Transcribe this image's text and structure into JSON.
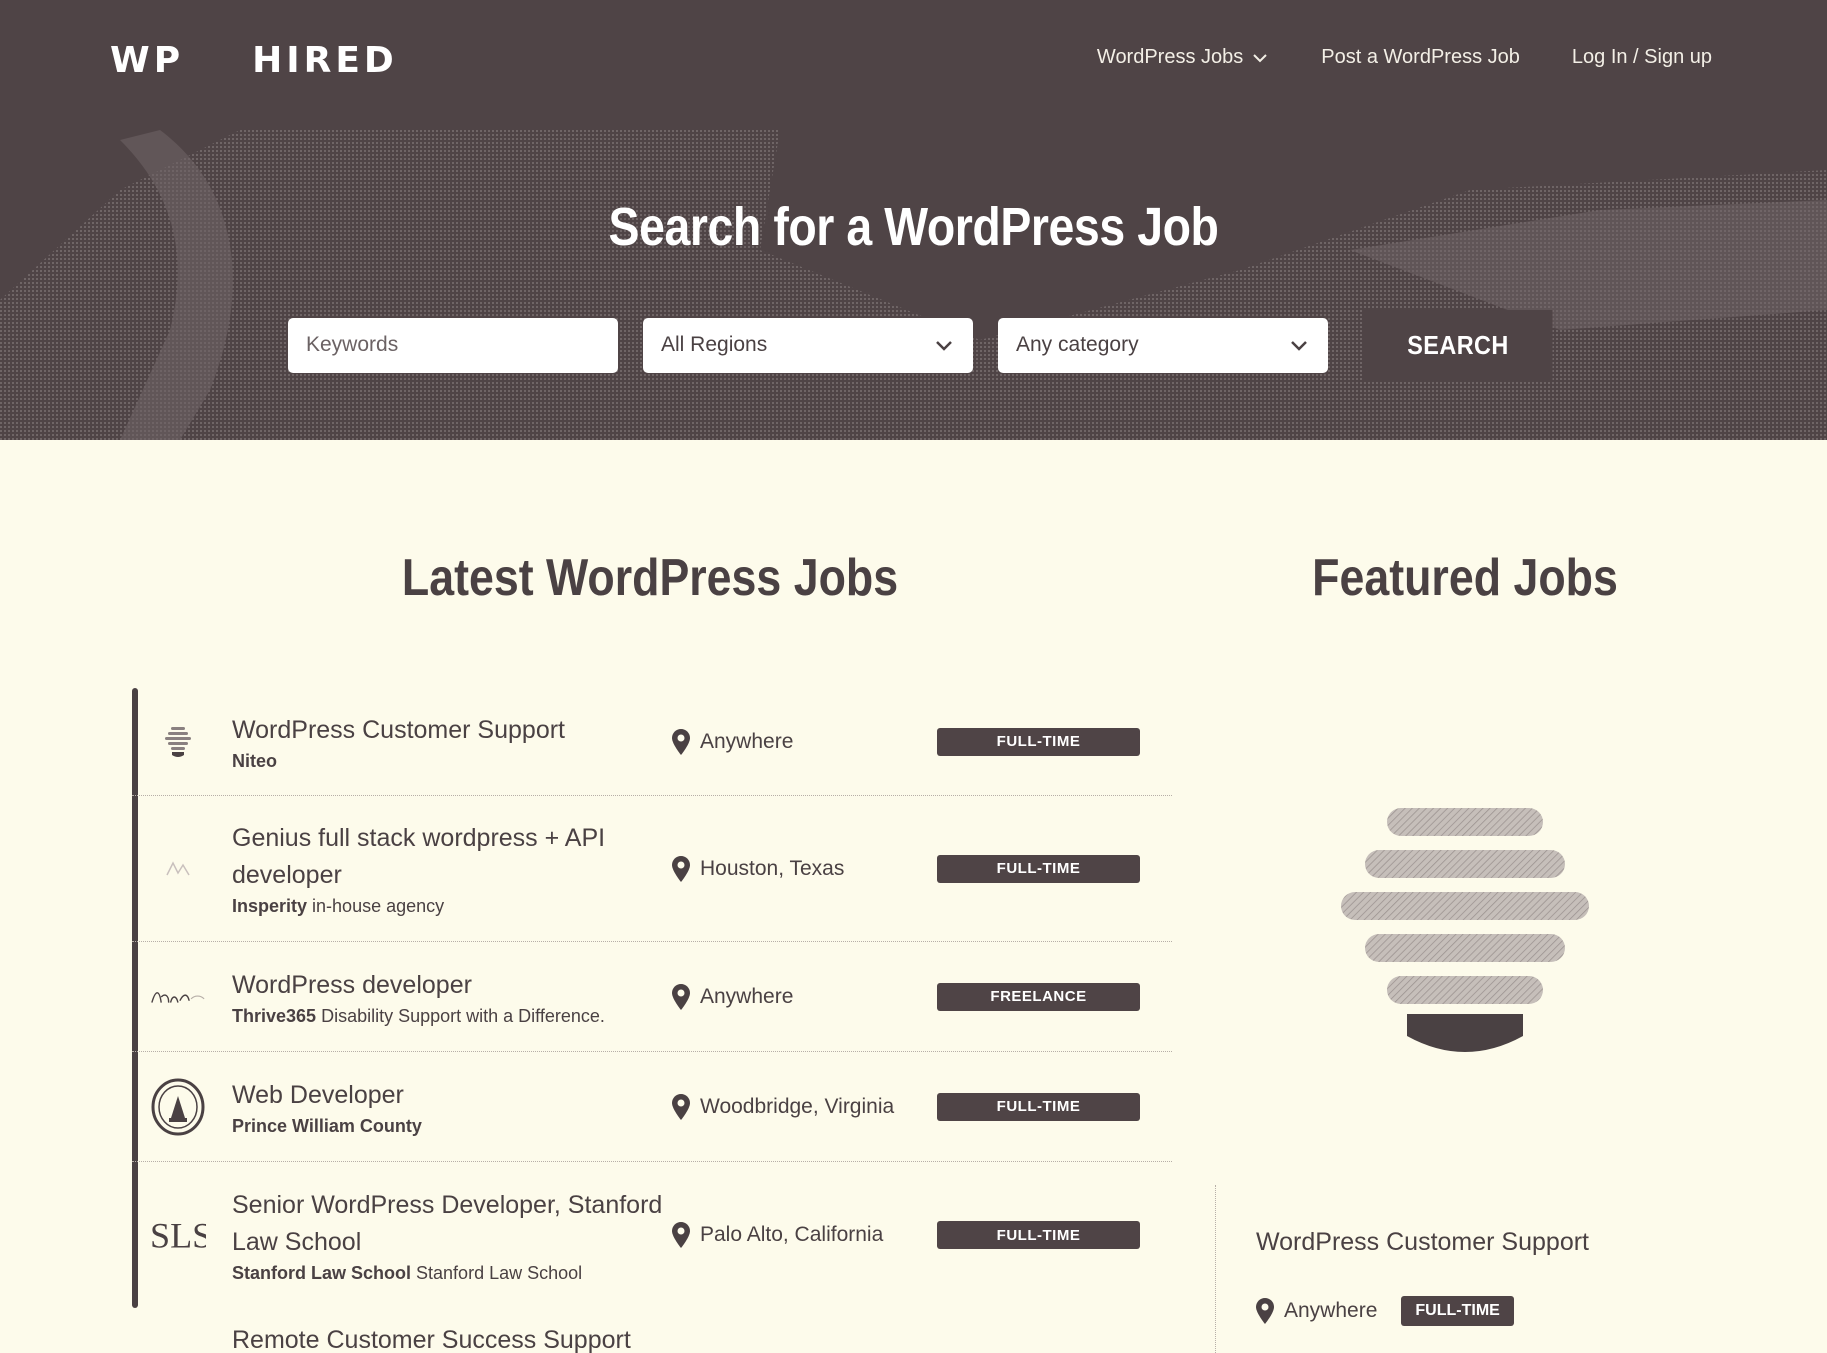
{
  "header": {
    "logo_part1": "WP",
    "logo_part2": "HIRED",
    "nav": {
      "jobs": "WordPress Jobs",
      "post": "Post a WordPress Job",
      "login": "Log In / Sign up"
    },
    "hero_title": "Search for a WordPress Job"
  },
  "search": {
    "keywords_placeholder": "Keywords",
    "region_value": "All Regions",
    "category_value": "Any category",
    "button": "SEARCH"
  },
  "latest": {
    "title": "Latest WordPress Jobs",
    "jobs": [
      {
        "title": "WordPress Customer Support",
        "company": "Niteo",
        "tagline": "",
        "location": "Anywhere",
        "type": "FULL-TIME",
        "logo_icon": "beehive-icon"
      },
      {
        "title": "Genius full stack wordpress + API developer",
        "company": "Insperity",
        "tagline": "in-house agency",
        "location": "Houston, Texas",
        "type": "FULL-TIME",
        "logo_icon": "insperity-logo"
      },
      {
        "title": "WordPress developer",
        "company": "Thrive365",
        "tagline": "Disability Support with a Difference.",
        "location": "Anywhere",
        "type": "FREELANCE",
        "logo_icon": "thrive-logo"
      },
      {
        "title": "Web Developer",
        "company": "Prince William County",
        "tagline": "",
        "location": "Woodbridge, Virginia",
        "type": "FULL-TIME",
        "logo_icon": "county-seal"
      },
      {
        "title": "Senior WordPress Developer, Stanford Law School",
        "company": "Stanford Law School",
        "tagline": "Stanford Law School",
        "location": "Palo Alto, California",
        "type": "FULL-TIME",
        "logo_icon": "sls-logo"
      },
      {
        "title": "Remote Customer Success Support",
        "company": "",
        "tagline": "",
        "location": "",
        "type": "",
        "logo_icon": ""
      }
    ]
  },
  "featured": {
    "title": "Featured Jobs",
    "job": {
      "title": "WordPress Customer Support",
      "location": "Anywhere",
      "type": "FULL-TIME"
    }
  },
  "colors": {
    "header_bg": "#4f4446",
    "page_bg": "#fdfbeb",
    "text": "#4a4143"
  }
}
